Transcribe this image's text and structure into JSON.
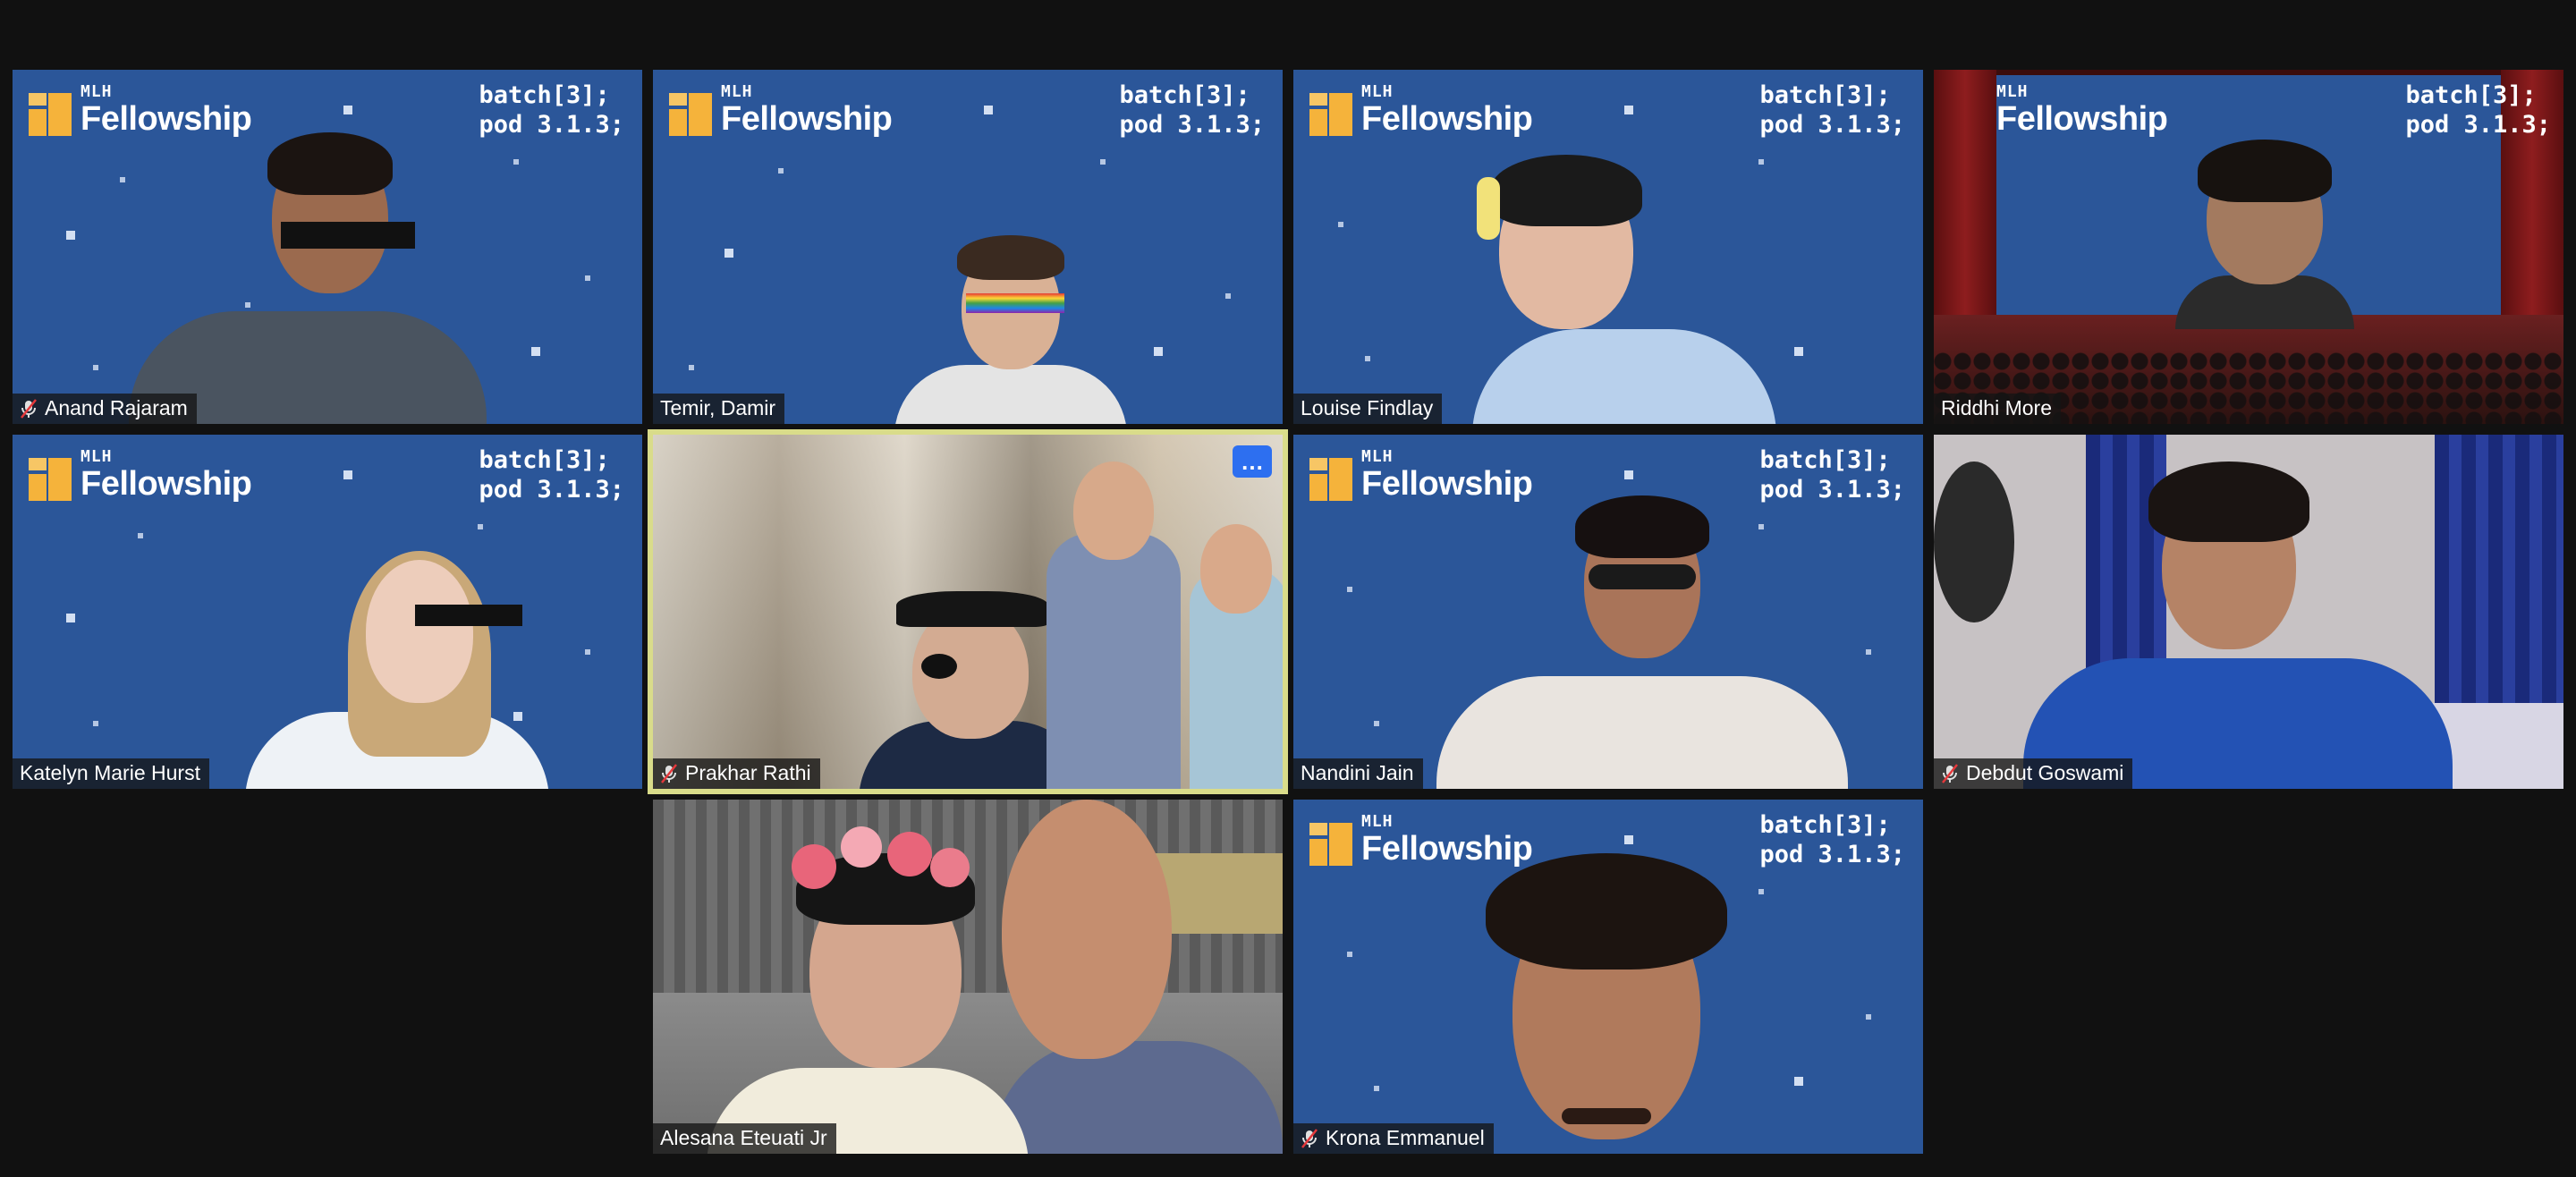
{
  "window": {
    "background": "#111111"
  },
  "branding": {
    "logo_small": "MLH",
    "logo_big": "Fellowship",
    "code_line1": "batch[3];",
    "code_line2": "pod 3.1.3;",
    "bg_color": "#2b5699",
    "accent": "#f5b33b"
  },
  "participants": [
    {
      "name": "Anand Rajaram",
      "muted": true,
      "background": "mlh"
    },
    {
      "name": "Temir, Damir",
      "muted": false,
      "background": "mlh"
    },
    {
      "name": "Louise Findlay",
      "muted": false,
      "background": "mlh"
    },
    {
      "name": "Riddhi More",
      "muted": false,
      "background": "theater"
    },
    {
      "name": "Katelyn Marie Hurst",
      "muted": false,
      "background": "mlh"
    },
    {
      "name": "Prakhar Rathi",
      "muted": true,
      "background": "street",
      "active_speaker": true,
      "more_button": "…"
    },
    {
      "name": "Nandini Jain",
      "muted": false,
      "background": "mlh"
    },
    {
      "name": "Debdut Goswami",
      "muted": true,
      "background": "room"
    },
    {
      "name": "Alesana Eteuati Jr",
      "muted": false,
      "background": "garage"
    },
    {
      "name": "Krona Emmanuel",
      "muted": true,
      "background": "mlh"
    }
  ]
}
